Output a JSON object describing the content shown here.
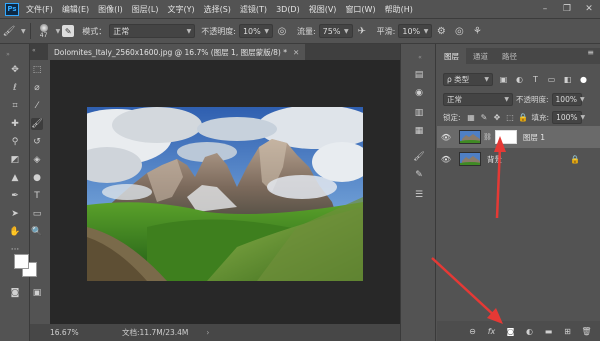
{
  "menubar": {
    "logo": "Ps",
    "items": [
      "文件(F)",
      "编辑(E)",
      "图像(I)",
      "图层(L)",
      "文字(Y)",
      "选择(S)",
      "滤镜(T)",
      "3D(D)",
      "视图(V)",
      "窗口(W)",
      "帮助(H)"
    ]
  },
  "options": {
    "brush_size": "47",
    "mode_label": "模式：",
    "mode_value": "正常",
    "opacity_label": "不透明度:",
    "opacity_value": "10%",
    "flow_label": "流量:",
    "flow_value": "75%",
    "smoothing_label": "平滑:",
    "smoothing_value": "10%"
  },
  "document": {
    "tab_title": "Dolomites_Italy_2560x1600.jpg @ 16.7% (图层 1, 图层蒙版/8) *",
    "zoom": "16.67%",
    "doc_info": "文档:11.7M/23.4M"
  },
  "layers_panel": {
    "tabs": [
      "图层",
      "通道",
      "路径"
    ],
    "filter_kind": "ρ 类型",
    "blend_mode": "正常",
    "opacity_label": "不透明度:",
    "opacity_value": "100%",
    "lock_label": "锁定:",
    "fill_label": "填充:",
    "fill_value": "100%",
    "layers": [
      {
        "name": "图层 1",
        "selected": true
      },
      {
        "name": "背景",
        "selected": false
      }
    ]
  },
  "colors": {
    "annotation_arrow": "#e53935",
    "selected_layer": "#6a6a6a"
  }
}
